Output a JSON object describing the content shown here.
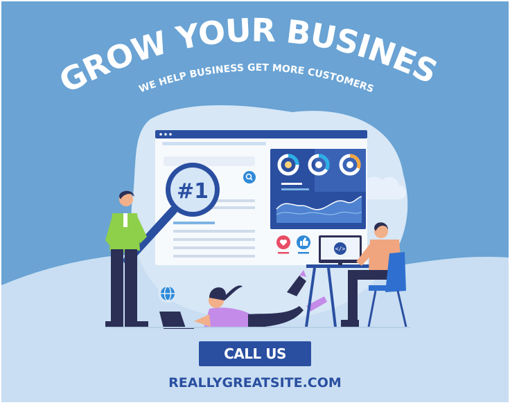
{
  "headline": "GROW YOUR BUSINESS",
  "tagline": "WE HELP BUSINESS GET MORE CUSTOMERS",
  "rank_badge": "#1",
  "code_icon_text": "</>",
  "cta_label": "CALL US",
  "website": "REALLYGREATSITE.COM",
  "colors": {
    "background": "#6aa3d4",
    "accent_dark_blue": "#2a4fa1",
    "light_blob": "#c9def2",
    "headline_text": "#ffffff"
  },
  "icons": [
    "magnifier-icon",
    "search-icon",
    "globe-icon",
    "heart-icon",
    "thumbs-up-icon",
    "code-icon",
    "laptop-icon",
    "monitor-icon",
    "chair-icon"
  ]
}
